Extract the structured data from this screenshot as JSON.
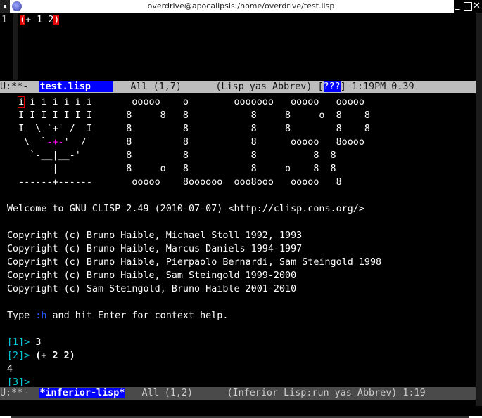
{
  "window": {
    "title": "overdrive@apocalipsis:/home/overdrive/test.lisp",
    "controls": {
      "minimize": "_",
      "maximize": "",
      "close": "✕"
    }
  },
  "editor": {
    "line_number": "1",
    "code_open": "(",
    "code_mid": "+ 1 2",
    "code_close": ")"
  },
  "modeline_top": {
    "status": "U:**-  ",
    "buffer": "test.lisp    ",
    "position": "   All (1,7)      (Lisp yas Abbrev) [",
    "unknown": "???",
    "tail": "] 1:19PM 0.39"
  },
  "banner": {
    "art": [
      [
        "",
        "i",
        " i i i i i i       ooooo    o        ooooooo   ooooo   ooooo"
      ],
      [
        "  I I I I I I I      8     8   8           8     8     o  8    8"
      ],
      [
        "  I  \\ `+' /  I      8         8           8     8        8    8"
      ],
      [
        "   \\  `",
        "-+-",
        "'  /       8         8           8      ooooo   8oooo"
      ],
      [
        "    `-__|__-'        8         8           8          8  8"
      ],
      [
        "        |            8     o   8           8     o    8  8"
      ],
      [
        "  ------+------       ooooo    8oooooo  ooo8ooo   ooooo   8"
      ]
    ],
    "welcome": "Welcome to GNU CLISP 2.49 (2010-07-07) <http://clisp.cons.org/>",
    "copyright": [
      "Copyright (c) Bruno Haible, Michael Stoll 1992, 1993",
      "Copyright (c) Bruno Haible, Marcus Daniels 1994-1997",
      "Copyright (c) Bruno Haible, Pierpaolo Bernardi, Sam Steingold 1998",
      "Copyright (c) Bruno Haible, Sam Steingold 1999-2000",
      "Copyright (c) Sam Steingold, Bruno Haible 2001-2010"
    ],
    "help_pre": "Type ",
    "help_cmd": ":h",
    "help_post": " and hit Enter for context help."
  },
  "repl": [
    {
      "prompt": "[1]> ",
      "input": "3",
      "bold": false
    },
    {
      "prompt": "[2]> ",
      "input": "(+ 2 2)",
      "bold": true
    },
    {
      "output": "4"
    },
    {
      "prompt": "[3]> ",
      "input": ""
    }
  ],
  "modeline_bottom": {
    "status": "U:**-  ",
    "buffer": "*inferior-lisp*",
    "tail": "   All (1,2)      (Inferior Lisp:run yas Abbrev) 1:19"
  }
}
